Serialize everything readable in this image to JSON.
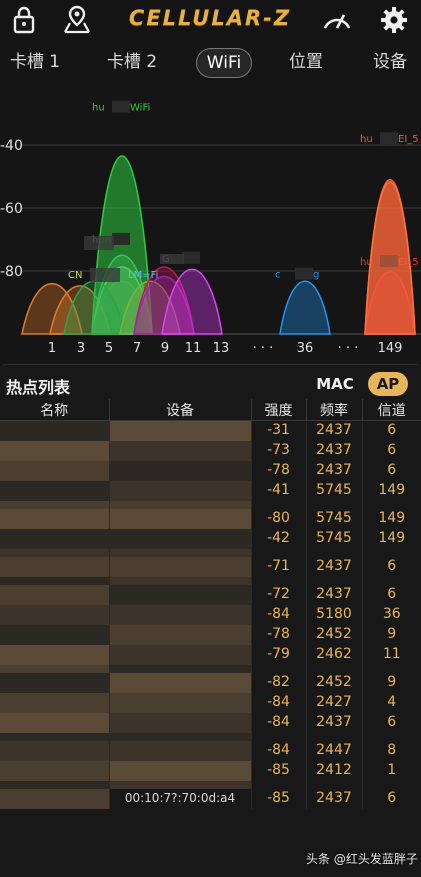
{
  "app": {
    "brand": "CELLULAR-Z"
  },
  "topbar": {
    "icons": [
      "lock-icon",
      "map-pin-icon",
      "speedometer-icon",
      "gear-icon"
    ]
  },
  "tabs": [
    {
      "label": "卡槽 1",
      "active": false
    },
    {
      "label": "卡槽 2",
      "active": false
    },
    {
      "label": "WiFi",
      "active": true
    },
    {
      "label": "位置",
      "active": false
    },
    {
      "label": "设备",
      "active": false
    }
  ],
  "chart_data": {
    "type": "area",
    "ylabel_ticks": [
      "-40",
      "-60",
      "-80"
    ],
    "ylim": [
      -100,
      -20
    ],
    "x_tick_labels": [
      "1",
      "3",
      "5",
      "7",
      "9",
      "11",
      "13",
      "· · ·",
      "36",
      "· · ·",
      "149"
    ],
    "grid": true,
    "series": [
      {
        "channel": 1,
        "rssi": -85,
        "color": "#e07a2a"
      },
      {
        "channel": 3,
        "rssi": -86,
        "color": "#e07a2a"
      },
      {
        "channel": 6,
        "rssi": -31,
        "color": "#2ecc40",
        "name_fragments": [
          "hu",
          "WiFi"
        ]
      },
      {
        "channel": 6,
        "rssi": -73,
        "color": "#3fc060",
        "name_fragments": [
          "hun"
        ]
      },
      {
        "channel": 6,
        "rssi": -78,
        "color": "#55d060"
      },
      {
        "channel": 6,
        "rssi": -84,
        "color": "#4caf50"
      },
      {
        "channel": 4,
        "rssi": -84,
        "color": "#2aa44c"
      },
      {
        "channel": 8,
        "rssi": -84,
        "color": "#7cb342"
      },
      {
        "channel": 9,
        "rssi": -78,
        "color": "#c2185b"
      },
      {
        "channel": 9,
        "rssi": -82,
        "color": "#9c27b0"
      },
      {
        "channel": 11,
        "rssi": -79,
        "color": "#e040fb",
        "name_fragments": [
          "G"
        ]
      },
      {
        "channel": 36,
        "rssi": -84,
        "color": "#2196f3",
        "name_fragments": [
          "c",
          "g"
        ]
      },
      {
        "channel": 149,
        "rssi": -41,
        "color": "#ff5722",
        "name_fragments": [
          "hu",
          "EI_5"
        ]
      },
      {
        "channel": 149,
        "rssi": -80,
        "color": "#e53935",
        "name_fragments": [
          "hu",
          "EI_5"
        ]
      },
      {
        "channel": 149,
        "rssi": -42,
        "color": "#ff7043"
      }
    ],
    "label_fragments": [
      "CN",
      "LM=Fi"
    ]
  },
  "hotspot_list": {
    "title": "热点列表",
    "mac_label": "MAC",
    "ap_label": "AP",
    "columns": [
      "名称",
      "设备",
      "强度",
      "频率",
      "信道"
    ],
    "rows": [
      {
        "strength": "-31",
        "freq": "2437",
        "channel": "6"
      },
      {
        "strength": "-73",
        "freq": "2437",
        "channel": "6"
      },
      {
        "strength": "-78",
        "freq": "2437",
        "channel": "6"
      },
      {
        "strength": "-41",
        "freq": "5745",
        "channel": "149"
      },
      {
        "strength": "",
        "freq": "",
        "channel": ""
      },
      {
        "strength": "-80",
        "freq": "5745",
        "channel": "149"
      },
      {
        "strength": "-42",
        "freq": "5745",
        "channel": "149"
      },
      {
        "strength": "",
        "freq": "",
        "channel": ""
      },
      {
        "strength": "-71",
        "freq": "2437",
        "channel": "6"
      },
      {
        "strength": "",
        "freq": "",
        "channel": ""
      },
      {
        "strength": "-72",
        "freq": "2437",
        "channel": "6"
      },
      {
        "strength": "-84",
        "freq": "5180",
        "channel": "36"
      },
      {
        "strength": "-78",
        "freq": "2452",
        "channel": "9"
      },
      {
        "strength": "-79",
        "freq": "2462",
        "channel": "11"
      },
      {
        "strength": "",
        "freq": "",
        "channel": ""
      },
      {
        "strength": "-82",
        "freq": "2452",
        "channel": "9"
      },
      {
        "strength": "-84",
        "freq": "2427",
        "channel": "4"
      },
      {
        "strength": "-84",
        "freq": "2437",
        "channel": "6"
      },
      {
        "strength": "",
        "freq": "",
        "channel": ""
      },
      {
        "strength": "-84",
        "freq": "2447",
        "channel": "8"
      },
      {
        "strength": "-85",
        "freq": "2412",
        "channel": "1"
      },
      {
        "strength": "",
        "freq": "",
        "channel": ""
      },
      {
        "strength": "-85",
        "freq": "2437",
        "channel": "6"
      }
    ],
    "visible_device_fragment": "00:10:7?:70:0d:a4"
  },
  "watermark": "头条 @红头发蓝胖子"
}
